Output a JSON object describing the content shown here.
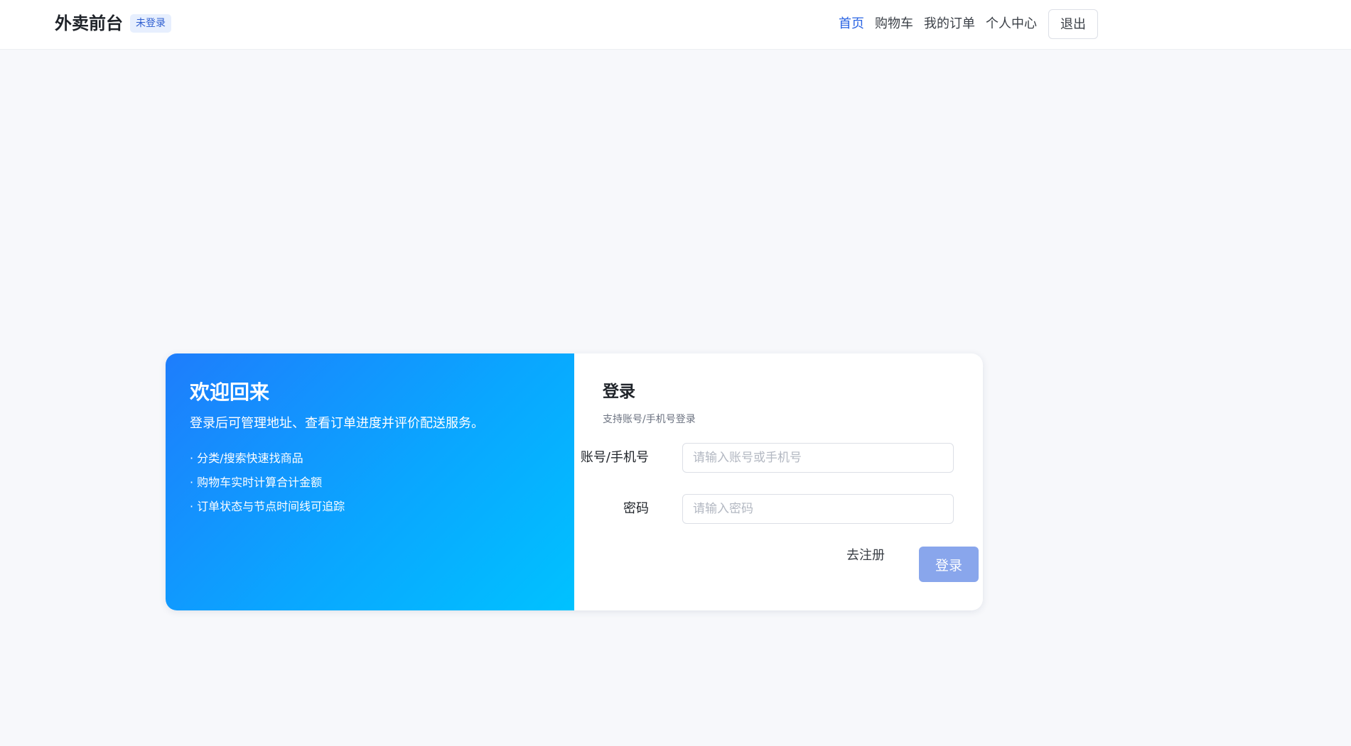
{
  "header": {
    "brand": "外卖前台",
    "status_badge": "未登录",
    "nav": [
      {
        "label": "首页",
        "active": true
      },
      {
        "label": "购物车",
        "active": false
      },
      {
        "label": "我的订单",
        "active": false
      },
      {
        "label": "个人中心",
        "active": false
      }
    ],
    "logout_label": "退出"
  },
  "welcome": {
    "title": "欢迎回来",
    "subtitle": "登录后可管理地址、查看订单进度并评价配送服务。",
    "features": [
      "· 分类/搜索快速找商品",
      "· 购物车实时计算合计金额",
      "· 订单状态与节点时间线可追踪"
    ]
  },
  "login_form": {
    "title": "登录",
    "subtitle": "支持账号/手机号登录",
    "account_label": "账号/手机号",
    "account_value": "",
    "account_placeholder": "请输入账号或手机号",
    "password_label": "密码",
    "password_value": "",
    "password_placeholder": "请输入密码",
    "register_label": "去注册",
    "submit_label": "登录"
  },
  "colors": {
    "accent": "#2a64e3",
    "gradient_start": "#1e7dfc",
    "gradient_end": "#00c2ff",
    "submit_disabled": "#89a6ec"
  }
}
